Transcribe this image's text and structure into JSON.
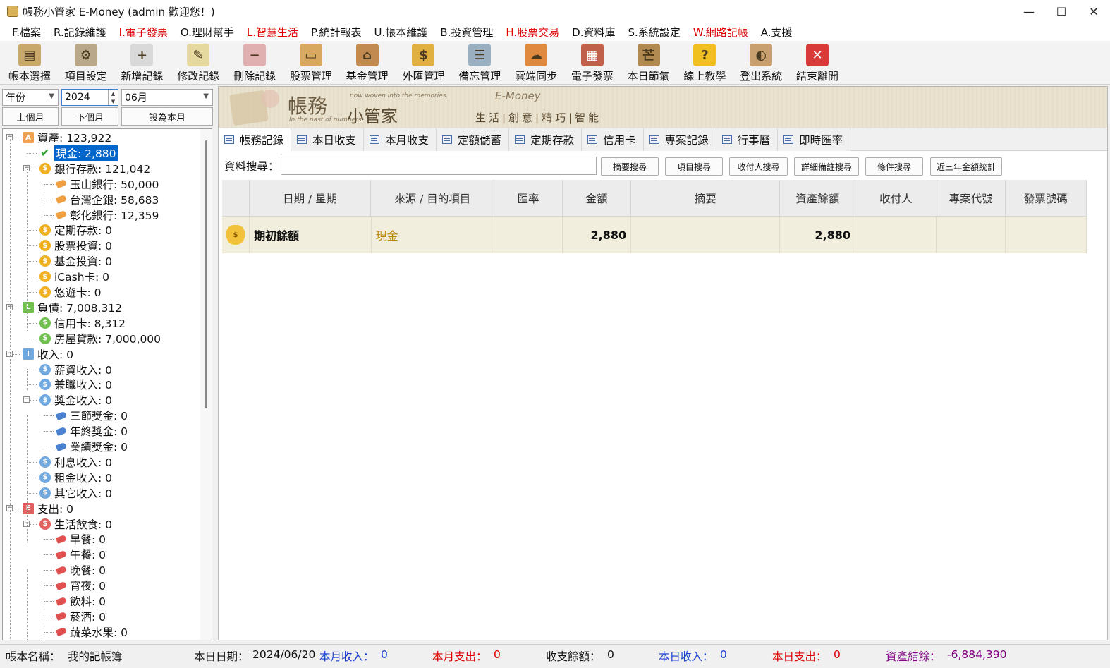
{
  "window": {
    "title": "帳務小管家 E-Money (admin 歡迎您！)",
    "minimize": "—",
    "maximize": "☐",
    "close": "✕"
  },
  "menu": [
    {
      "key": "F",
      "label": ".檔案",
      "red": false
    },
    {
      "key": "R",
      "label": ".記錄維護",
      "red": false
    },
    {
      "key": "I",
      "label": ".電子發票",
      "red": true
    },
    {
      "key": "O",
      "label": ".理財幫手",
      "red": false
    },
    {
      "key": "L",
      "label": ".智慧生活",
      "red": true
    },
    {
      "key": "P",
      "label": ".統計報表",
      "red": false
    },
    {
      "key": "U",
      "label": ".帳本維護",
      "red": false
    },
    {
      "key": "B",
      "label": ".投資管理",
      "red": false
    },
    {
      "key": "H",
      "label": ".股票交易",
      "red": true
    },
    {
      "key": "D",
      "label": ".資料庫",
      "red": false
    },
    {
      "key": "S",
      "label": ".系統設定",
      "red": false
    },
    {
      "key": "W",
      "label": ".網路記帳",
      "red": true
    },
    {
      "key": "A",
      "label": ".支援",
      "red": false
    }
  ],
  "toolbar": [
    {
      "label": "帳本選擇",
      "icon": "ledger-icon",
      "color": "#c9a96b"
    },
    {
      "label": "項目設定",
      "icon": "gear-icon",
      "color": "#b9a98a"
    },
    {
      "label": "新增記錄",
      "icon": "add-doc-icon",
      "color": "#d9d9d9"
    },
    {
      "label": "修改記錄",
      "icon": "edit-doc-icon",
      "color": "#e5d9a0"
    },
    {
      "label": "刪除記錄",
      "icon": "delete-doc-icon",
      "color": "#e0b0b0"
    },
    {
      "label": "股票管理",
      "icon": "stock-icon",
      "color": "#d9a860"
    },
    {
      "label": "基金管理",
      "icon": "fund-icon",
      "color": "#c08a50"
    },
    {
      "label": "外匯管理",
      "icon": "exchange-icon",
      "color": "#e0b040"
    },
    {
      "label": "備忘管理",
      "icon": "memo-icon",
      "color": "#9ab0c0"
    },
    {
      "label": "雲端同步",
      "icon": "cloud-sync-icon",
      "color": "#e08a40"
    },
    {
      "label": "電子發票",
      "icon": "qrcode-icon",
      "color": "#c0604a"
    },
    {
      "label": "本日節氣",
      "icon": "solar-term-icon",
      "color": "#b08a50"
    },
    {
      "label": "線上教學",
      "icon": "help-icon",
      "color": "#f0c020"
    },
    {
      "label": "登出系統",
      "icon": "logout-icon",
      "color": "#c8a070"
    },
    {
      "label": "結束離開",
      "icon": "exit-icon",
      "color": "#d83a3a"
    }
  ],
  "filter": {
    "period": "年份",
    "year": "2024",
    "month": "06月",
    "prev": "上個月",
    "next": "下個月",
    "current": "設為本月"
  },
  "tree": [
    {
      "level": 0,
      "label": "資產: 123,922",
      "badge": "A",
      "color": "#f0a050",
      "exp": "−",
      "kind": "box"
    },
    {
      "level": 1,
      "label": "現金: 2,880",
      "badge": "✔",
      "color": "#2aa02a",
      "exp": "",
      "kind": "check",
      "selected": true
    },
    {
      "level": 1,
      "label": "銀行存款: 121,042",
      "badge": "$",
      "color": "#f0b020",
      "exp": "−",
      "kind": "coin"
    },
    {
      "level": 2,
      "label": "玉山銀行: 50,000",
      "badge": "",
      "color": "#f0a040",
      "exp": "",
      "kind": "tag"
    },
    {
      "level": 2,
      "label": "台灣企銀: 58,683",
      "badge": "",
      "color": "#f0a040",
      "exp": "",
      "kind": "tag"
    },
    {
      "level": 2,
      "label": "彰化銀行: 12,359",
      "badge": "",
      "color": "#f0a040",
      "exp": "",
      "kind": "tag"
    },
    {
      "level": 1,
      "label": "定期存款: 0",
      "badge": "$",
      "color": "#f0b020",
      "exp": "",
      "kind": "coin"
    },
    {
      "level": 1,
      "label": "股票投資: 0",
      "badge": "$",
      "color": "#f0b020",
      "exp": "",
      "kind": "coin"
    },
    {
      "level": 1,
      "label": "基金投資: 0",
      "badge": "$",
      "color": "#f0b020",
      "exp": "",
      "kind": "coin"
    },
    {
      "level": 1,
      "label": "iCash卡: 0",
      "badge": "$",
      "color": "#f0b020",
      "exp": "",
      "kind": "coin"
    },
    {
      "level": 1,
      "label": "悠遊卡: 0",
      "badge": "$",
      "color": "#f0b020",
      "exp": "",
      "kind": "coin"
    },
    {
      "level": 0,
      "label": "負債: 7,008,312",
      "badge": "L",
      "color": "#70c050",
      "exp": "−",
      "kind": "box"
    },
    {
      "level": 1,
      "label": "信用卡: 8,312",
      "badge": "$",
      "color": "#70c050",
      "exp": "",
      "kind": "coin"
    },
    {
      "level": 1,
      "label": "房屋貸款: 7,000,000",
      "badge": "$",
      "color": "#70c050",
      "exp": "",
      "kind": "coin"
    },
    {
      "level": 0,
      "label": "收入: 0",
      "badge": "I",
      "color": "#70a8e0",
      "exp": "−",
      "kind": "box"
    },
    {
      "level": 1,
      "label": "薪資收入: 0",
      "badge": "$",
      "color": "#70a8e0",
      "exp": "",
      "kind": "coin"
    },
    {
      "level": 1,
      "label": "兼職收入: 0",
      "badge": "$",
      "color": "#70a8e0",
      "exp": "",
      "kind": "coin"
    },
    {
      "level": 1,
      "label": "獎金收入: 0",
      "badge": "$",
      "color": "#70a8e0",
      "exp": "−",
      "kind": "coin"
    },
    {
      "level": 2,
      "label": "三節獎金: 0",
      "badge": "",
      "color": "#4a80d0",
      "exp": "",
      "kind": "tag"
    },
    {
      "level": 2,
      "label": "年終獎金: 0",
      "badge": "",
      "color": "#4a80d0",
      "exp": "",
      "kind": "tag"
    },
    {
      "level": 2,
      "label": "業績獎金: 0",
      "badge": "",
      "color": "#4a80d0",
      "exp": "",
      "kind": "tag"
    },
    {
      "level": 1,
      "label": "利息收入: 0",
      "badge": "$",
      "color": "#70a8e0",
      "exp": "",
      "kind": "coin"
    },
    {
      "level": 1,
      "label": "租金收入: 0",
      "badge": "$",
      "color": "#70a8e0",
      "exp": "",
      "kind": "coin"
    },
    {
      "level": 1,
      "label": "其它收入: 0",
      "badge": "$",
      "color": "#70a8e0",
      "exp": "",
      "kind": "coin"
    },
    {
      "level": 0,
      "label": "支出: 0",
      "badge": "E",
      "color": "#e06060",
      "exp": "−",
      "kind": "box"
    },
    {
      "level": 1,
      "label": "生活飲食: 0",
      "badge": "$",
      "color": "#e06060",
      "exp": "−",
      "kind": "coin"
    },
    {
      "level": 2,
      "label": "早餐: 0",
      "badge": "",
      "color": "#e05050",
      "exp": "",
      "kind": "tag"
    },
    {
      "level": 2,
      "label": "午餐: 0",
      "badge": "",
      "color": "#e05050",
      "exp": "",
      "kind": "tag"
    },
    {
      "level": 2,
      "label": "晚餐: 0",
      "badge": "",
      "color": "#e05050",
      "exp": "",
      "kind": "tag"
    },
    {
      "level": 2,
      "label": "宵夜: 0",
      "badge": "",
      "color": "#e05050",
      "exp": "",
      "kind": "tag"
    },
    {
      "level": 2,
      "label": "飲料: 0",
      "badge": "",
      "color": "#e05050",
      "exp": "",
      "kind": "tag"
    },
    {
      "level": 2,
      "label": "菸酒: 0",
      "badge": "",
      "color": "#e05050",
      "exp": "",
      "kind": "tag"
    },
    {
      "level": 2,
      "label": "蔬菜水果: 0",
      "badge": "",
      "color": "#e05050",
      "exp": "",
      "kind": "tag"
    }
  ],
  "banner": {
    "title1": "帳務",
    "title2": "小管家",
    "tagline1": "now woven into the memories.",
    "tagline2": "In the past of numbers.",
    "brand": "E-Money",
    "slogan": "生活|創意|精巧|智能"
  },
  "tabs": [
    "帳務記錄",
    "本日收支",
    "本月收支",
    "定額儲蓄",
    "定期存款",
    "信用卡",
    "專案記錄",
    "行事曆",
    "即時匯率"
  ],
  "search": {
    "label": "資料搜尋：",
    "value": "",
    "buttons": [
      "摘要搜尋",
      "項目搜尋",
      "收付人搜尋",
      "詳細備註搜尋",
      "條件搜尋",
      "近三年金額統計"
    ]
  },
  "grid": {
    "columns": [
      "",
      "日期 / 星期",
      "來源 / 目的項目",
      "匯率",
      "金額",
      "摘要",
      "資產餘額",
      "收付人",
      "專案代號",
      "發票號碼"
    ],
    "rows": [
      {
        "icon": "money-bag-icon",
        "date": "期初餘額",
        "item": "現金",
        "rate": "",
        "amount": "2,880",
        "memo": "",
        "balance": "2,880",
        "payee": "",
        "project": "",
        "invoice": ""
      }
    ]
  },
  "status": {
    "book_label": "帳本名稱：",
    "book": "我的記帳簿",
    "date_label": "本日日期：",
    "date": "2024/06/20",
    "month_income_label": "本月收入：",
    "month_income": "0",
    "month_expense_label": "本月支出：",
    "month_expense": "0",
    "net_label": "收支餘額：",
    "net": "0",
    "day_income_label": "本日收入：",
    "day_income": "0",
    "day_expense_label": "本日支出：",
    "day_expense": "0",
    "asset_label": "資產結餘：",
    "asset": "-6,884,390"
  }
}
